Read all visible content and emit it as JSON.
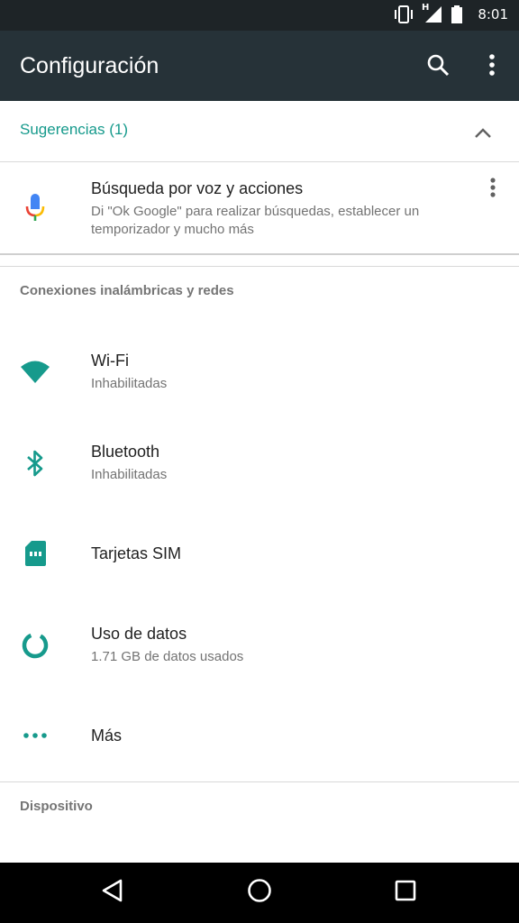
{
  "status_bar": {
    "time": "8:01",
    "network_type": "H"
  },
  "app_bar": {
    "title": "Configuración",
    "search_icon": "search-icon",
    "more_icon": "more-vert-icon"
  },
  "suggestions": {
    "header_label": "Sugerencias (1)",
    "collapse_icon": "chevron-up-icon",
    "items": [
      {
        "title": "Búsqueda por voz y acciones",
        "subtitle": "Di \"Ok Google\" para realizar búsquedas, establecer un temporizador y mucho más",
        "icon": "mic-icon"
      }
    ]
  },
  "sections": [
    {
      "header": "Conexiones inalámbricas y redes",
      "items": [
        {
          "title": "Wi-Fi",
          "subtitle": "Inhabilitadas",
          "icon": "wifi-icon"
        },
        {
          "title": "Bluetooth",
          "subtitle": "Inhabilitadas",
          "icon": "bluetooth-icon"
        },
        {
          "title": "Tarjetas SIM",
          "subtitle": "",
          "icon": "sim-card-icon"
        },
        {
          "title": "Uso de datos",
          "subtitle": "1.71 GB de datos usados",
          "icon": "data-usage-icon"
        },
        {
          "title": "Más",
          "subtitle": "",
          "icon": "more-horiz-icon"
        }
      ]
    },
    {
      "header": "Dispositivo",
      "items": []
    }
  ],
  "colors": {
    "accent": "#169a8c",
    "app_bar": "#263238",
    "status_bar": "#1e2427"
  },
  "nav_bar": {
    "back_icon": "back-icon",
    "home_icon": "home-icon",
    "recents_icon": "recents-icon"
  }
}
